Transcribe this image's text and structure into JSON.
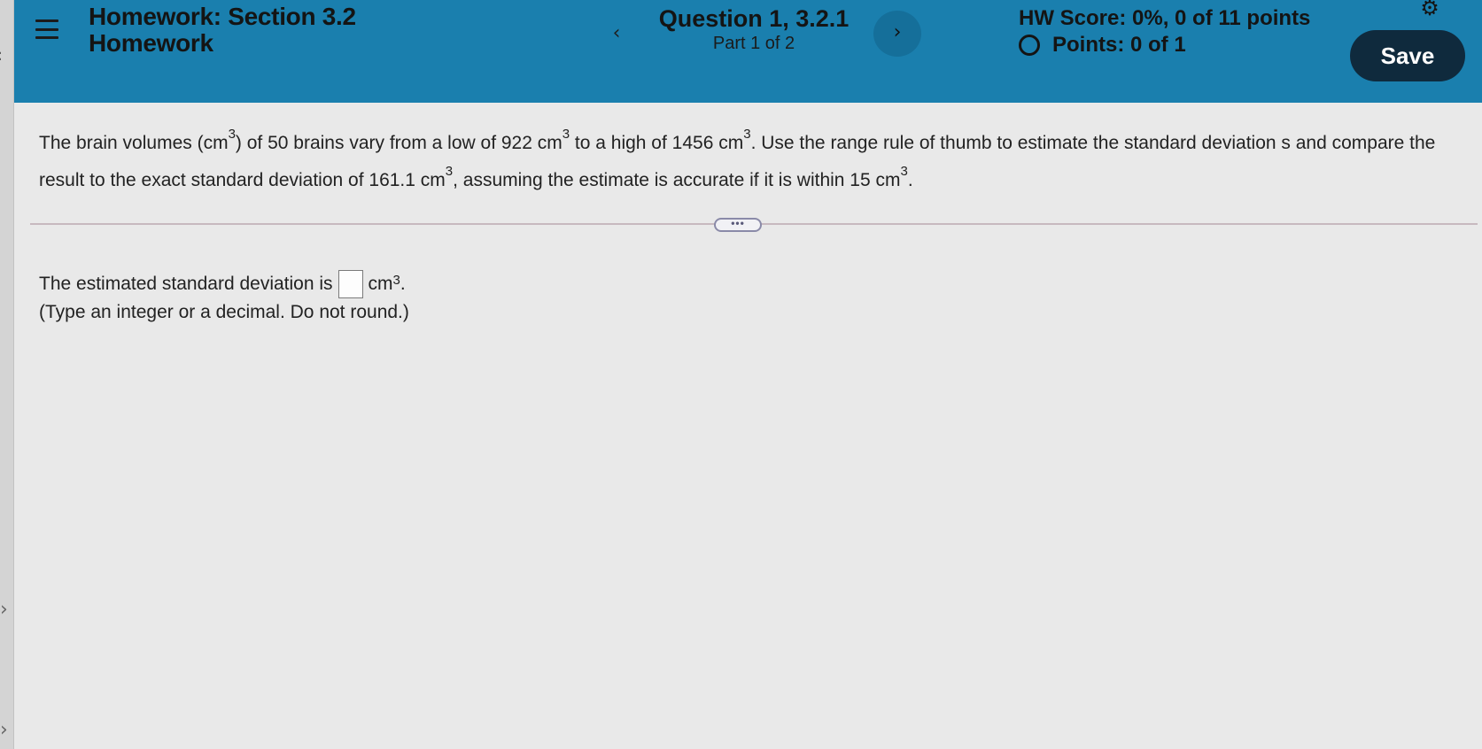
{
  "header": {
    "hw_title_line1": "Homework: Section 3.2",
    "hw_title_line2": "Homework",
    "question_title": "Question 1, 3.2.1",
    "part_label": "Part 1 of 2",
    "hw_score": "HW Score: 0%, 0 of 11 points",
    "points": "Points: 0 of 1",
    "save_label": "Save",
    "prev_glyph": "‹",
    "next_glyph": "›",
    "gear_glyph": "⚙"
  },
  "question": {
    "t1": "The brain volumes (cm",
    "t2": ") of 50 brains vary from a low of 922 cm",
    "t3": " to a high of 1456 cm",
    "t4": ". Use the range rule of thumb to estimate the standard deviation s and compare the result to the exact standard deviation of 161.1 cm",
    "t5": ", assuming the estimate is accurate if it is within 15 cm",
    "t6": ".",
    "exp": "3"
  },
  "expand_label": "•••",
  "answer": {
    "prefix": "The estimated standard deviation is",
    "unit": "cm",
    "exp": "3",
    "end": ".",
    "hint": "(Type an integer or a decimal. Do not round.)"
  },
  "icons": {
    "menu": "hamburger-icon",
    "prev": "chevron-left-icon",
    "next": "chevron-right-icon",
    "settings": "gear-icon",
    "points_status": "circle-icon"
  }
}
